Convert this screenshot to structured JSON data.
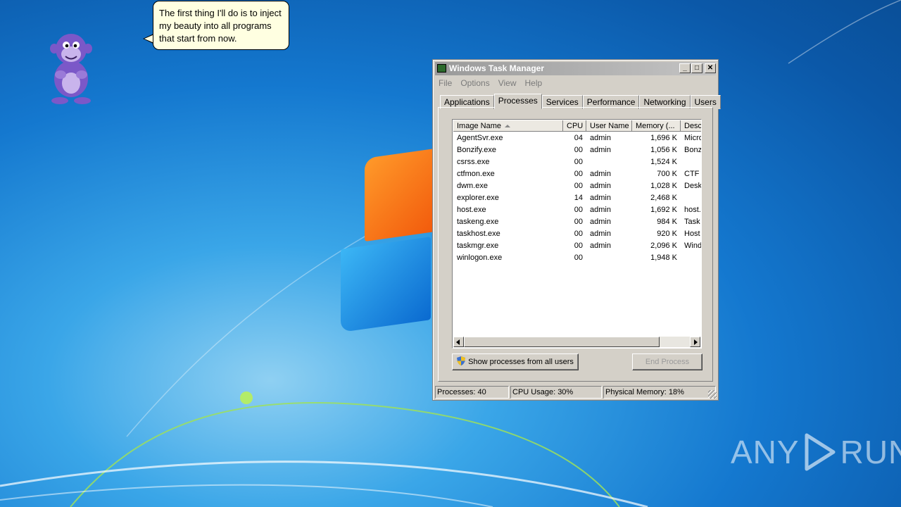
{
  "desktop": {
    "watermark": {
      "left": "ANY",
      "right": "RUN"
    }
  },
  "bonzi": {
    "speech": "The first thing I'll do is to inject my beauty into all programs that start from now."
  },
  "task_manager": {
    "title": "Windows Task Manager",
    "menu": [
      "File",
      "Options",
      "View",
      "Help"
    ],
    "tabs": [
      "Applications",
      "Processes",
      "Services",
      "Performance",
      "Networking",
      "Users"
    ],
    "active_tab": "Processes",
    "columns": [
      "Image Name",
      "CPU",
      "User Name",
      "Memory (...",
      "Desc"
    ],
    "processes": [
      {
        "name": "AgentSvr.exe",
        "cpu": "04",
        "user": "admin",
        "memory": "1,696 K",
        "desc": "Micro"
      },
      {
        "name": "Bonzify.exe",
        "cpu": "00",
        "user": "admin",
        "memory": "1,056 K",
        "desc": "Bonz"
      },
      {
        "name": "csrss.exe",
        "cpu": "00",
        "user": "",
        "memory": "1,524 K",
        "desc": ""
      },
      {
        "name": "ctfmon.exe",
        "cpu": "00",
        "user": "admin",
        "memory": "700 K",
        "desc": "CTF L"
      },
      {
        "name": "dwm.exe",
        "cpu": "00",
        "user": "admin",
        "memory": "1,028 K",
        "desc": "Desk"
      },
      {
        "name": "explorer.exe",
        "cpu": "14",
        "user": "admin",
        "memory": "2,468 K",
        "desc": ""
      },
      {
        "name": "host.exe",
        "cpu": "00",
        "user": "admin",
        "memory": "1,692 K",
        "desc": "host."
      },
      {
        "name": "taskeng.exe",
        "cpu": "00",
        "user": "admin",
        "memory": "984 K",
        "desc": "Task"
      },
      {
        "name": "taskhost.exe",
        "cpu": "00",
        "user": "admin",
        "memory": "920 K",
        "desc": "Host"
      },
      {
        "name": "taskmgr.exe",
        "cpu": "00",
        "user": "admin",
        "memory": "2,096 K",
        "desc": "Wind"
      },
      {
        "name": "winlogon.exe",
        "cpu": "00",
        "user": "",
        "memory": "1,948 K",
        "desc": ""
      }
    ],
    "show_all_button": "Show processes from all users",
    "end_process_button": "End Process",
    "status": {
      "processes": "Processes: 40",
      "cpu": "CPU Usage: 30%",
      "memory": "Physical Memory: 18%"
    }
  }
}
